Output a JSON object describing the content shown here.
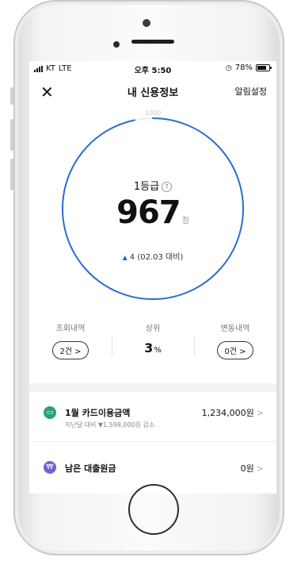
{
  "status_bar": {
    "carrier": "KT",
    "network": "LTE",
    "time": "오후 5:50",
    "battery": "78%",
    "battery_level": 0.78
  },
  "nav": {
    "close_glyph": "✕",
    "title": "내 신용정보",
    "right_label": "알림설정"
  },
  "gauge": {
    "max_label": "1000",
    "grade": "1등급",
    "help_glyph": "?",
    "score": "967",
    "score_unit": "점",
    "score_value": 967,
    "score_max": 1000,
    "delta_glyph": "▲",
    "delta_text": "4 (02.03 대비)",
    "ring_color": "#2f6bd0"
  },
  "stats": {
    "inquiry": {
      "label": "조회내역",
      "button": "2건 >"
    },
    "rank": {
      "label": "상위",
      "value": "3",
      "unit": "%"
    },
    "changes": {
      "label": "변동내역",
      "button": "0건 >"
    }
  },
  "list": [
    {
      "icon": "card-icon",
      "icon_glyph": "▭",
      "icon_color": "#27a370",
      "title": "1월 카드이용금액",
      "subtitle": "지난달 대비 ▼1,598,000원 감소",
      "amount": "1,234,000원",
      "chev": ">"
    },
    {
      "icon": "won-icon",
      "icon_glyph": "₩",
      "icon_color": "#6c63d6",
      "title": "남은 대출원금",
      "subtitle": "",
      "amount": "0원",
      "chev": ">"
    }
  ]
}
